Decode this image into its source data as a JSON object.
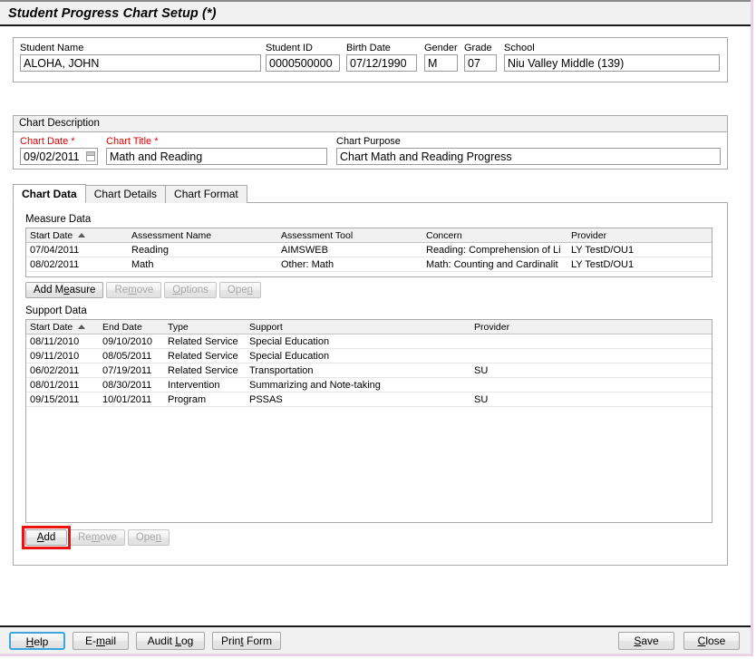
{
  "window": {
    "title": "Student Progress Chart Setup (*)"
  },
  "student": {
    "name_label": "Student Name",
    "name_value": "ALOHA, JOHN",
    "id_label": "Student ID",
    "id_value": "0000500000",
    "birthdate_label": "Birth Date",
    "birthdate_value": "07/12/1990",
    "gender_label": "Gender",
    "gender_value": "M",
    "grade_label": "Grade",
    "grade_value": "07",
    "school_label": "School",
    "school_value": "Niu Valley Middle (139)"
  },
  "chart_description": {
    "group_title": "Chart Description",
    "chart_date_label": "Chart Date",
    "chart_date_required": "*",
    "chart_date_value": "09/02/2011",
    "chart_title_label": "Chart Title",
    "chart_title_required": "*",
    "chart_title_value": "Math and Reading",
    "chart_purpose_label": "Chart Purpose",
    "chart_purpose_value": "Chart Math and Reading Progress"
  },
  "tabs": [
    {
      "label": "Chart Data",
      "active": true
    },
    {
      "label": "Chart Details",
      "active": false
    },
    {
      "label": "Chart Format",
      "active": false
    }
  ],
  "measure_data": {
    "section_label": "Measure Data",
    "columns": [
      "Start Date",
      "Assessment Name",
      "Assessment Tool",
      "Concern",
      "Provider"
    ],
    "sorted_column": "Start Date",
    "sort_direction": "ascending",
    "rows": [
      {
        "start_date": "07/04/2011",
        "assessment_name": "Reading",
        "assessment_tool": "AIMSWEB",
        "concern": "Reading: Comprehension of Li",
        "provider": "LY TestD/OU1"
      },
      {
        "start_date": "08/02/2011",
        "assessment_name": "Math",
        "assessment_tool": "Other: Math",
        "concern": "Math: Counting and Cardinalit",
        "provider": "LY TestD/OU1"
      }
    ],
    "buttons": [
      {
        "label": "Add Measure",
        "mnemonic": "e",
        "disabled": false
      },
      {
        "label": "Remove",
        "mnemonic": "m",
        "disabled": true
      },
      {
        "label": "Options",
        "mnemonic": "O",
        "disabled": true
      },
      {
        "label": "Open",
        "mnemonic": "n",
        "disabled": true
      }
    ]
  },
  "support_data": {
    "section_label": "Support Data",
    "columns": [
      "Start Date",
      "End Date",
      "Type",
      "Support",
      "Provider"
    ],
    "sorted_column": "Start Date",
    "sort_direction": "ascending",
    "rows": [
      {
        "start_date": "08/11/2010",
        "end_date": "09/10/2010",
        "type": "Related Service",
        "support": "Special Education",
        "provider": ""
      },
      {
        "start_date": "09/11/2010",
        "end_date": "08/05/2011",
        "type": "Related Service",
        "support": "Special Education",
        "provider": ""
      },
      {
        "start_date": "06/02/2011",
        "end_date": "07/19/2011",
        "type": "Related Service",
        "support": "Transportation",
        "provider": "SU"
      },
      {
        "start_date": "08/01/2011",
        "end_date": "08/30/2011",
        "type": "Intervention",
        "support": "Summarizing and Note-taking",
        "provider": ""
      },
      {
        "start_date": "09/15/2011",
        "end_date": "10/01/2011",
        "type": "Program",
        "support": "PSSAS",
        "provider": "SU"
      }
    ],
    "buttons": [
      {
        "label": "Add",
        "mnemonic": "A",
        "disabled": false,
        "highlighted": true
      },
      {
        "label": "Remove",
        "mnemonic": "m",
        "disabled": true,
        "highlighted": false
      },
      {
        "label": "Open",
        "mnemonic": "n",
        "disabled": true,
        "highlighted": false
      }
    ]
  },
  "footer": {
    "help_label": "Help",
    "email_label": "E-mail",
    "audit_log_label": "Audit Log",
    "print_form_label": "Print Form",
    "save_label": "Save",
    "close_label": "Close"
  },
  "colors": {
    "required_red": "#e00000",
    "highlight_red": "#ee1111",
    "focus_blue": "#3ca5dd",
    "chrome_gray": "#f1f1f1",
    "border_gray": "#a9a9a9"
  }
}
